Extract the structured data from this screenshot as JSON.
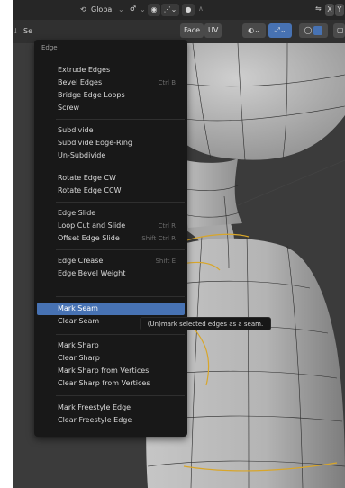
{
  "header": {
    "orientation_label": "Global",
    "right_buttons": [
      "X",
      "Y"
    ]
  },
  "toolbar": {
    "select_left_label": "Se",
    "face_label": "Face",
    "uv_label": "UV"
  },
  "menu": {
    "title": "Edge",
    "items": [
      {
        "label": "Extrude Edges",
        "shortcut": ""
      },
      {
        "label": "Bevel Edges",
        "shortcut": "Ctrl B"
      },
      {
        "label": "Bridge Edge Loops",
        "shortcut": ""
      },
      {
        "label": "Screw",
        "shortcut": ""
      },
      {
        "label": "Subdivide",
        "shortcut": ""
      },
      {
        "label": "Subdivide Edge-Ring",
        "shortcut": ""
      },
      {
        "label": "Un-Subdivide",
        "shortcut": ""
      },
      {
        "label": "Rotate Edge CW",
        "shortcut": ""
      },
      {
        "label": "Rotate Edge CCW",
        "shortcut": ""
      },
      {
        "label": "Edge Slide",
        "shortcut": ""
      },
      {
        "label": "Loop Cut and Slide",
        "shortcut": "Ctrl R"
      },
      {
        "label": "Offset Edge Slide",
        "shortcut": "Shift Ctrl R"
      },
      {
        "label": "Edge Crease",
        "shortcut": "Shift E"
      },
      {
        "label": "Edge Bevel Weight",
        "shortcut": ""
      },
      {
        "label": "Mark Seam",
        "shortcut": ""
      },
      {
        "label": "Clear Seam",
        "shortcut": ""
      },
      {
        "label": "Mark Sharp",
        "shortcut": ""
      },
      {
        "label": "Clear Sharp",
        "shortcut": ""
      },
      {
        "label": "Mark Sharp from Vertices",
        "shortcut": ""
      },
      {
        "label": "Clear Sharp from Vertices",
        "shortcut": ""
      },
      {
        "label": "Mark Freestyle Edge",
        "shortcut": ""
      },
      {
        "label": "Clear Freestyle Edge",
        "shortcut": ""
      }
    ],
    "highlighted": "Mark Seam"
  },
  "tooltip": {
    "text": "(Un)mark selected edges as a seam."
  },
  "colors": {
    "highlight": "#4772b3",
    "menu_bg": "#181818",
    "seam_edge": "#d8a62a"
  }
}
